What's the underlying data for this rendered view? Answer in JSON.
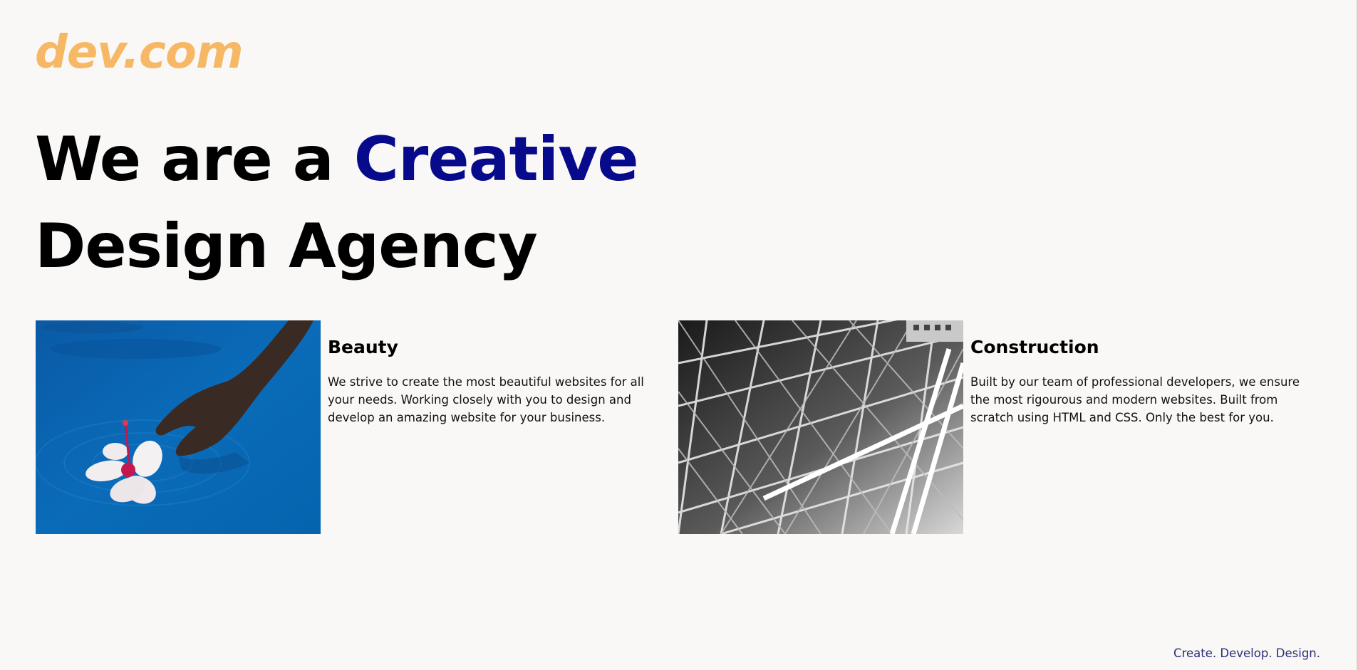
{
  "brand": {
    "logo_text": "dev.com"
  },
  "hero": {
    "line1_plain": "We are a ",
    "line1_accent": "Creative",
    "line2": "Design Agency"
  },
  "cards": [
    {
      "title": "Beauty",
      "text": "We strive to create the most beautiful websites for all your needs. Working closely with you to design and develop an amazing website for your business.",
      "image": "hand-in-water-with-hibiscus-photo"
    },
    {
      "title": "Construction",
      "text": "Built by our team of professional developers, we ensure the most rigourous and modern websites. Built from scratch using HTML and CSS. Only the best for you.",
      "image": "steel-lattice-structure-photo"
    }
  ],
  "footer": {
    "tagline": "Create. Develop. Design."
  },
  "colors": {
    "background": "#f9f8f6",
    "logo": "#f7b866",
    "accent": "#070a8a",
    "tagline": "#2b2d78"
  }
}
